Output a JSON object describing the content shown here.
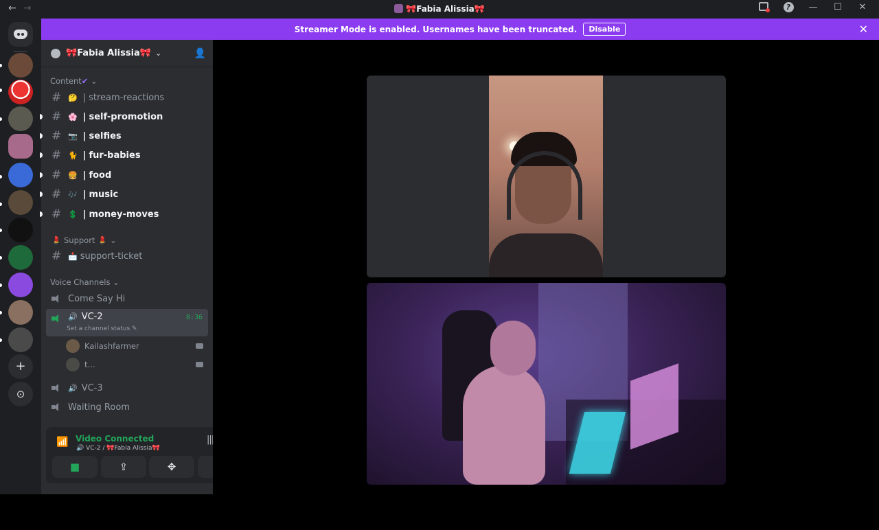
{
  "window": {
    "title": "Fabia Alissia",
    "title_bow_left": "🎀",
    "title_bow_right": "🎀"
  },
  "banner": {
    "text": "Streamer Mode is enabled. Usernames have been truncated.",
    "button": "Disable"
  },
  "server": {
    "name": "Fabia Alissia",
    "bow_left": "🎀",
    "bow_right": "🎀"
  },
  "categories": {
    "content": "Content",
    "content_check": "✔",
    "support": "Support",
    "support_emoji": "💄",
    "voice": "Voice Channels"
  },
  "text_channels": [
    {
      "name": "stream-reactions",
      "emoji": "🤔",
      "unread": false
    },
    {
      "name": "self-promotion",
      "emoji": "🌸",
      "unread": true
    },
    {
      "name": "selfies",
      "emoji": "📷",
      "unread": true
    },
    {
      "name": "fur-babies",
      "emoji": "🐈",
      "unread": true
    },
    {
      "name": "food",
      "emoji": "🍔",
      "unread": true
    },
    {
      "name": "music",
      "emoji": "🎶",
      "unread": true
    },
    {
      "name": "money-moves",
      "emoji": "💲",
      "unread": true
    }
  ],
  "support_channels": [
    {
      "name": "support-ticket",
      "emoji": "📩"
    }
  ],
  "voice_channels": {
    "come_say_hi": "Come Say Hi",
    "vc2": "VC-2",
    "vc2_timer": "8:36",
    "vc2_status": "Set a channel status",
    "users": [
      "Kailashfarmer",
      "t..."
    ],
    "vc3": "VC-3",
    "waiting": "Waiting Room"
  },
  "voice_panel": {
    "title": "Video Connected",
    "channel": "VC-2 /",
    "server": "Fabia Alissia",
    "bow": "🎀"
  },
  "colors": {
    "banner": "#8c3cf0",
    "connected_green": "#23a55a",
    "sidebar": "#2b2d31",
    "server_rail": "#1e1f22"
  }
}
